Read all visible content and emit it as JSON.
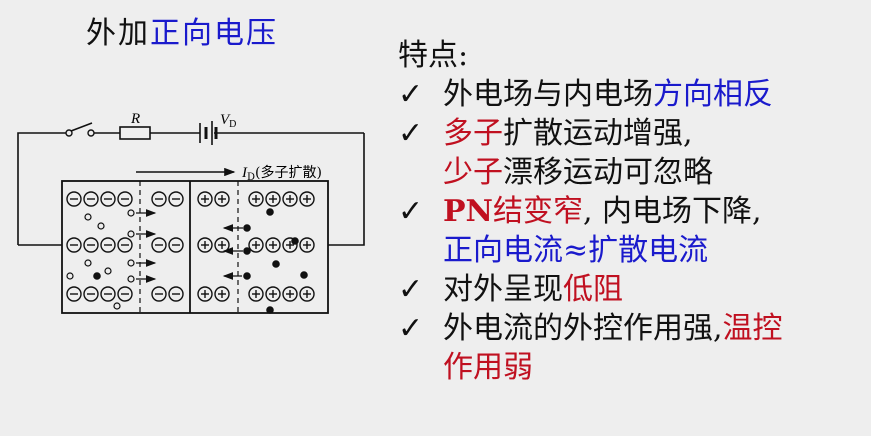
{
  "title": {
    "prefix": "外加",
    "highlight": "正向电压"
  },
  "diagram": {
    "resistor_label": "R",
    "battery_label": "V",
    "battery_sub": "D",
    "current_label": "I",
    "current_sub": "D",
    "current_note": "(多子扩散)"
  },
  "features": {
    "heading": "特点:",
    "check": "✓",
    "p1_a": "外电场与内电场",
    "p1_b": "方向相反",
    "p2_a": "多子",
    "p2_b": "扩散运动增强,",
    "p2_c": "少子",
    "p2_d": "漂移运动可忽略",
    "p3_a": "PN",
    "p3_b": "结变窄",
    "p3_c": ", 内电场下降,",
    "p3_d": "正向电流≈扩散电流",
    "p4_a": "对外呈现",
    "p4_b": "低阻",
    "p5_a": "外电流的外控作用强,",
    "p5_b": "温控",
    "p5_c": "作用弱"
  },
  "colors": {
    "red": "#c01020",
    "blue": "#1a1acc",
    "background": "#eeeeee"
  }
}
